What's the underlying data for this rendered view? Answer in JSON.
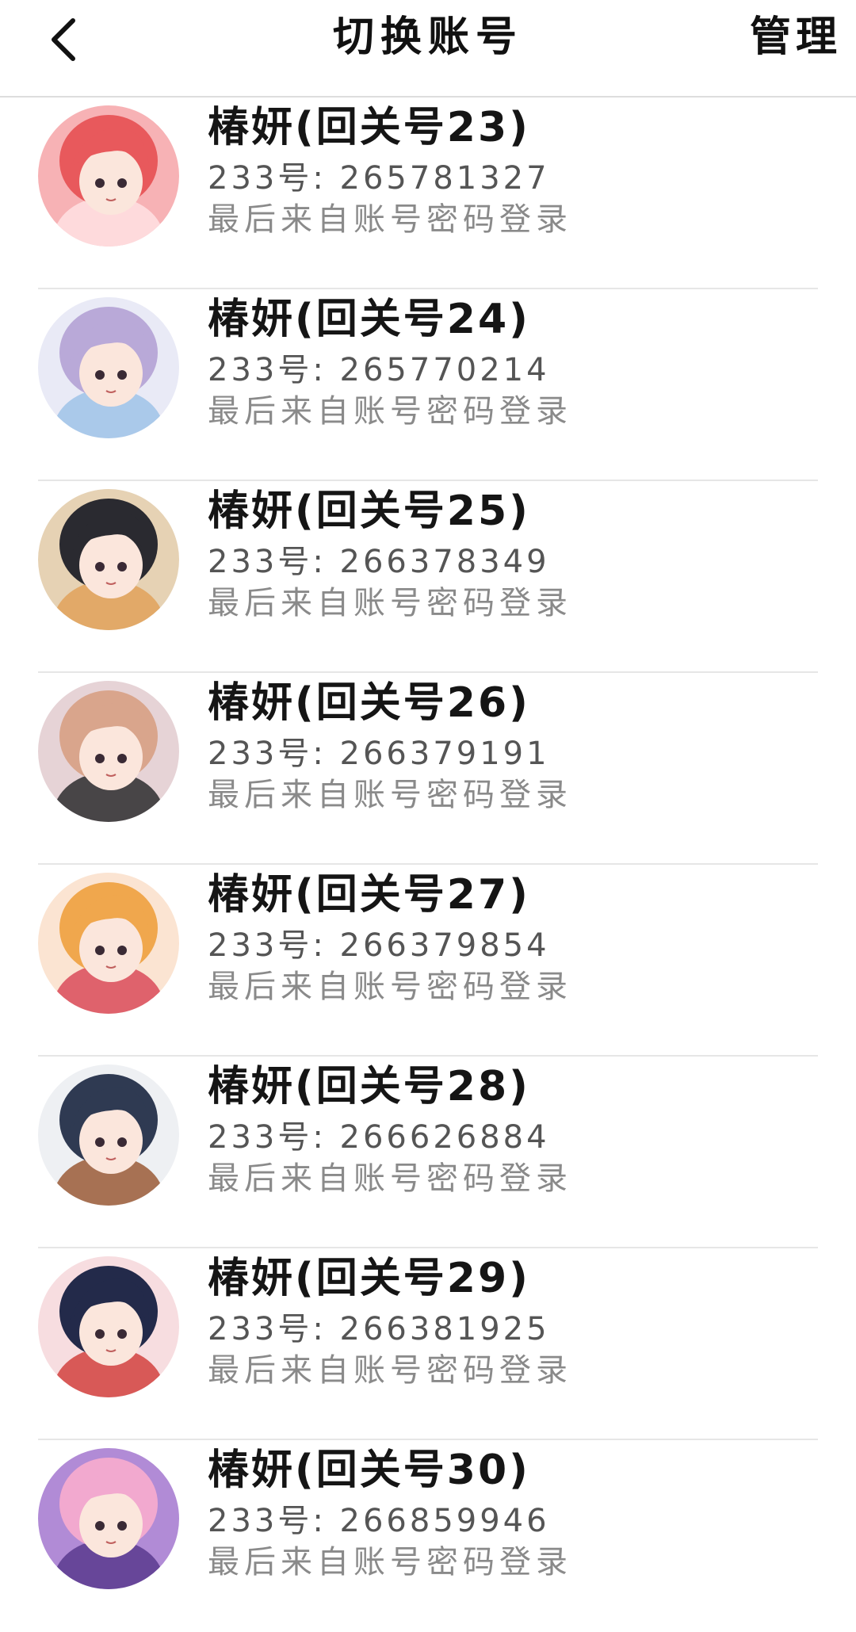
{
  "header": {
    "back_icon": "chevron-left-icon",
    "title": "切换账号",
    "manage_label": "管理"
  },
  "accounts": [
    {
      "name": "椿妍(回关号23)",
      "id_label": "233号: 265781327",
      "login_source": "最后来自账号密码登录",
      "avatar_colors": [
        "#f7b2b5",
        "#e8595c",
        "#ffe1e3"
      ]
    },
    {
      "name": "椿妍(回关号24)",
      "id_label": "233号: 265770214",
      "login_source": "最后来自账号密码登录",
      "avatar_colors": [
        "#e9eaf6",
        "#b9a9d8",
        "#9fc3e8"
      ]
    },
    {
      "name": "椿妍(回关号25)",
      "id_label": "233号: 266378349",
      "login_source": "最后来自账号密码登录",
      "avatar_colors": [
        "#e6d2b4",
        "#2a2a30",
        "#e0a25a"
      ]
    },
    {
      "name": "椿妍(回关号26)",
      "id_label": "233号: 266379191",
      "login_source": "最后来自账号密码登录",
      "avatar_colors": [
        "#e6d3d6",
        "#d9a58c",
        "#2b2b2e"
      ]
    },
    {
      "name": "椿妍(回关号27)",
      "id_label": "233号: 266379854",
      "login_source": "最后来自账号密码登录",
      "avatar_colors": [
        "#fbe4d2",
        "#f0a74d",
        "#d94b5a"
      ]
    },
    {
      "name": "椿妍(回关号28)",
      "id_label": "233号: 266626884",
      "login_source": "最后来自账号密码登录",
      "avatar_colors": [
        "#eef0f3",
        "#2f3a52",
        "#9a5b36"
      ]
    },
    {
      "name": "椿妍(回关号29)",
      "id_label": "233号: 266381925",
      "login_source": "最后来自账号密码登录",
      "avatar_colors": [
        "#f7dde0",
        "#232a4a",
        "#d2423e"
      ]
    },
    {
      "name": "椿妍(回关号30)",
      "id_label": "233号: 266859946",
      "login_source": "最后来自账号密码登录",
      "avatar_colors": [
        "#b18bd6",
        "#f2a9cf",
        "#5a3a8e"
      ]
    }
  ],
  "colors": {
    "divider": "#e6e6e6",
    "name_text": "#151515",
    "secondary_text": "#8a8a8a"
  }
}
